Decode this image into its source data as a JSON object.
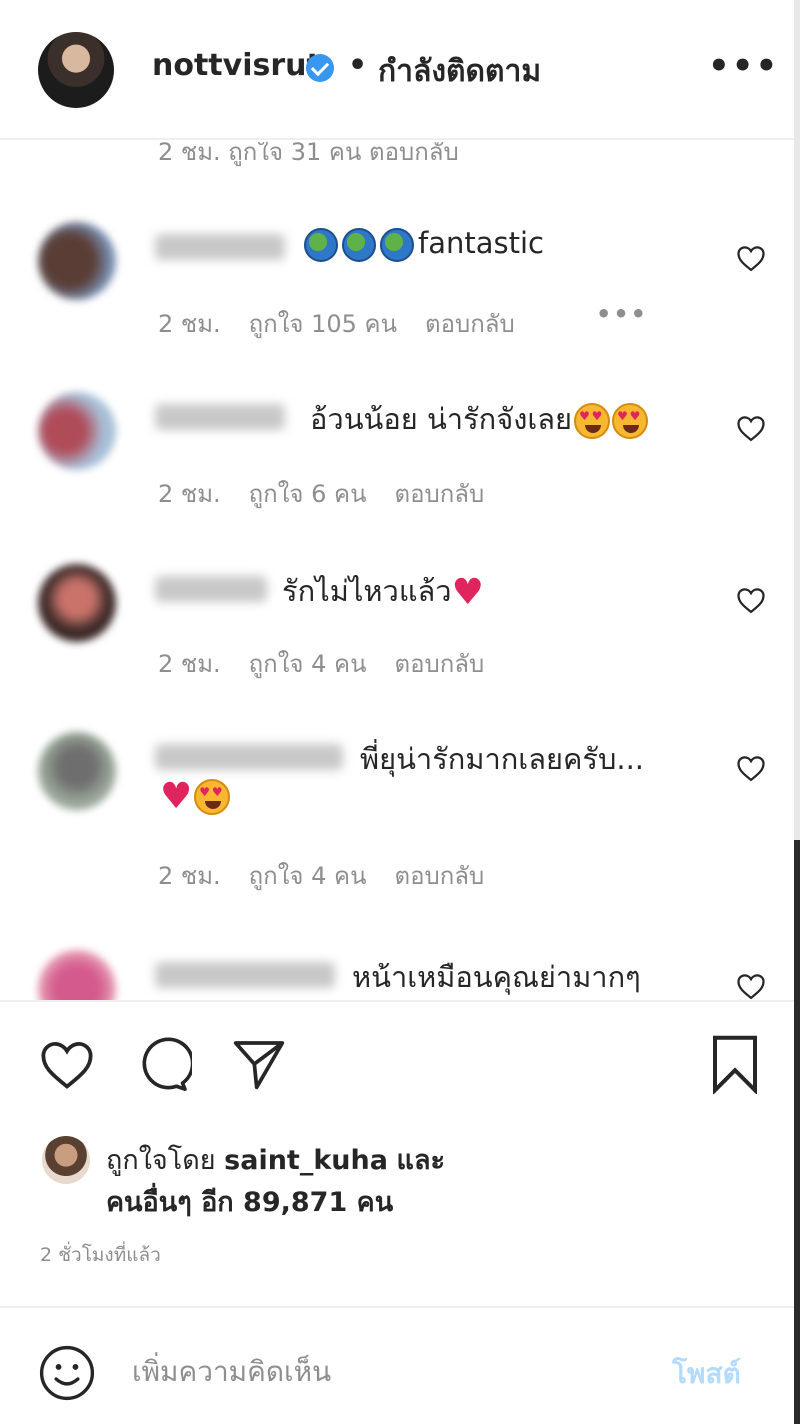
{
  "header": {
    "username": "nottvisrut",
    "separator": "•",
    "follow_status": "กำลังติดตาม",
    "more_label": "•••"
  },
  "cut_comment": {
    "meta": "2 ชม.   ถูกใจ 31 คน   ตอบกลับ"
  },
  "comments": [
    {
      "text": "fantastic",
      "time": "2 ชม.",
      "likes": "ถูกใจ 105 คน",
      "reply": "ตอบกลับ",
      "more": "•••"
    },
    {
      "text": "อ้วนน้อย น่ารักจังเลย",
      "time": "2 ชม.",
      "likes": "ถูกใจ 6 คน",
      "reply": "ตอบกลับ"
    },
    {
      "text": "รักไม่ไหวแล้ว",
      "time": "2 ชม.",
      "likes": "ถูกใจ 4 คน",
      "reply": "ตอบกลับ"
    },
    {
      "text": "พี่ยุน่ารักมากเลยครับ...",
      "time": "2 ชม.",
      "likes": "ถูกใจ 4 คน",
      "reply": "ตอบกลับ"
    },
    {
      "text": "หน้าเหมือนคุณย่ามากๆ"
    }
  ],
  "actions": {
    "liked_by_prefix": "ถูกใจโดย",
    "liked_by_user": "saint_kuha",
    "liked_by_suffix": "และ",
    "liked_others": "คนอื่นๆ อีก 89,871 คน",
    "time_ago": "2 ชั่วโมงที่แล้ว"
  },
  "add_comment": {
    "placeholder": "เพิ่มความคิดเห็น",
    "post_label": "โพสต์"
  },
  "colors": {
    "verified": "#3897f0",
    "secondary_text": "#8e8e8e",
    "post_disabled": "#b3dbff"
  },
  "icons": [
    "verified-badge-icon",
    "more-icon",
    "heart-icon",
    "comment-icon",
    "share-icon",
    "bookmark-icon",
    "smile-icon"
  ]
}
